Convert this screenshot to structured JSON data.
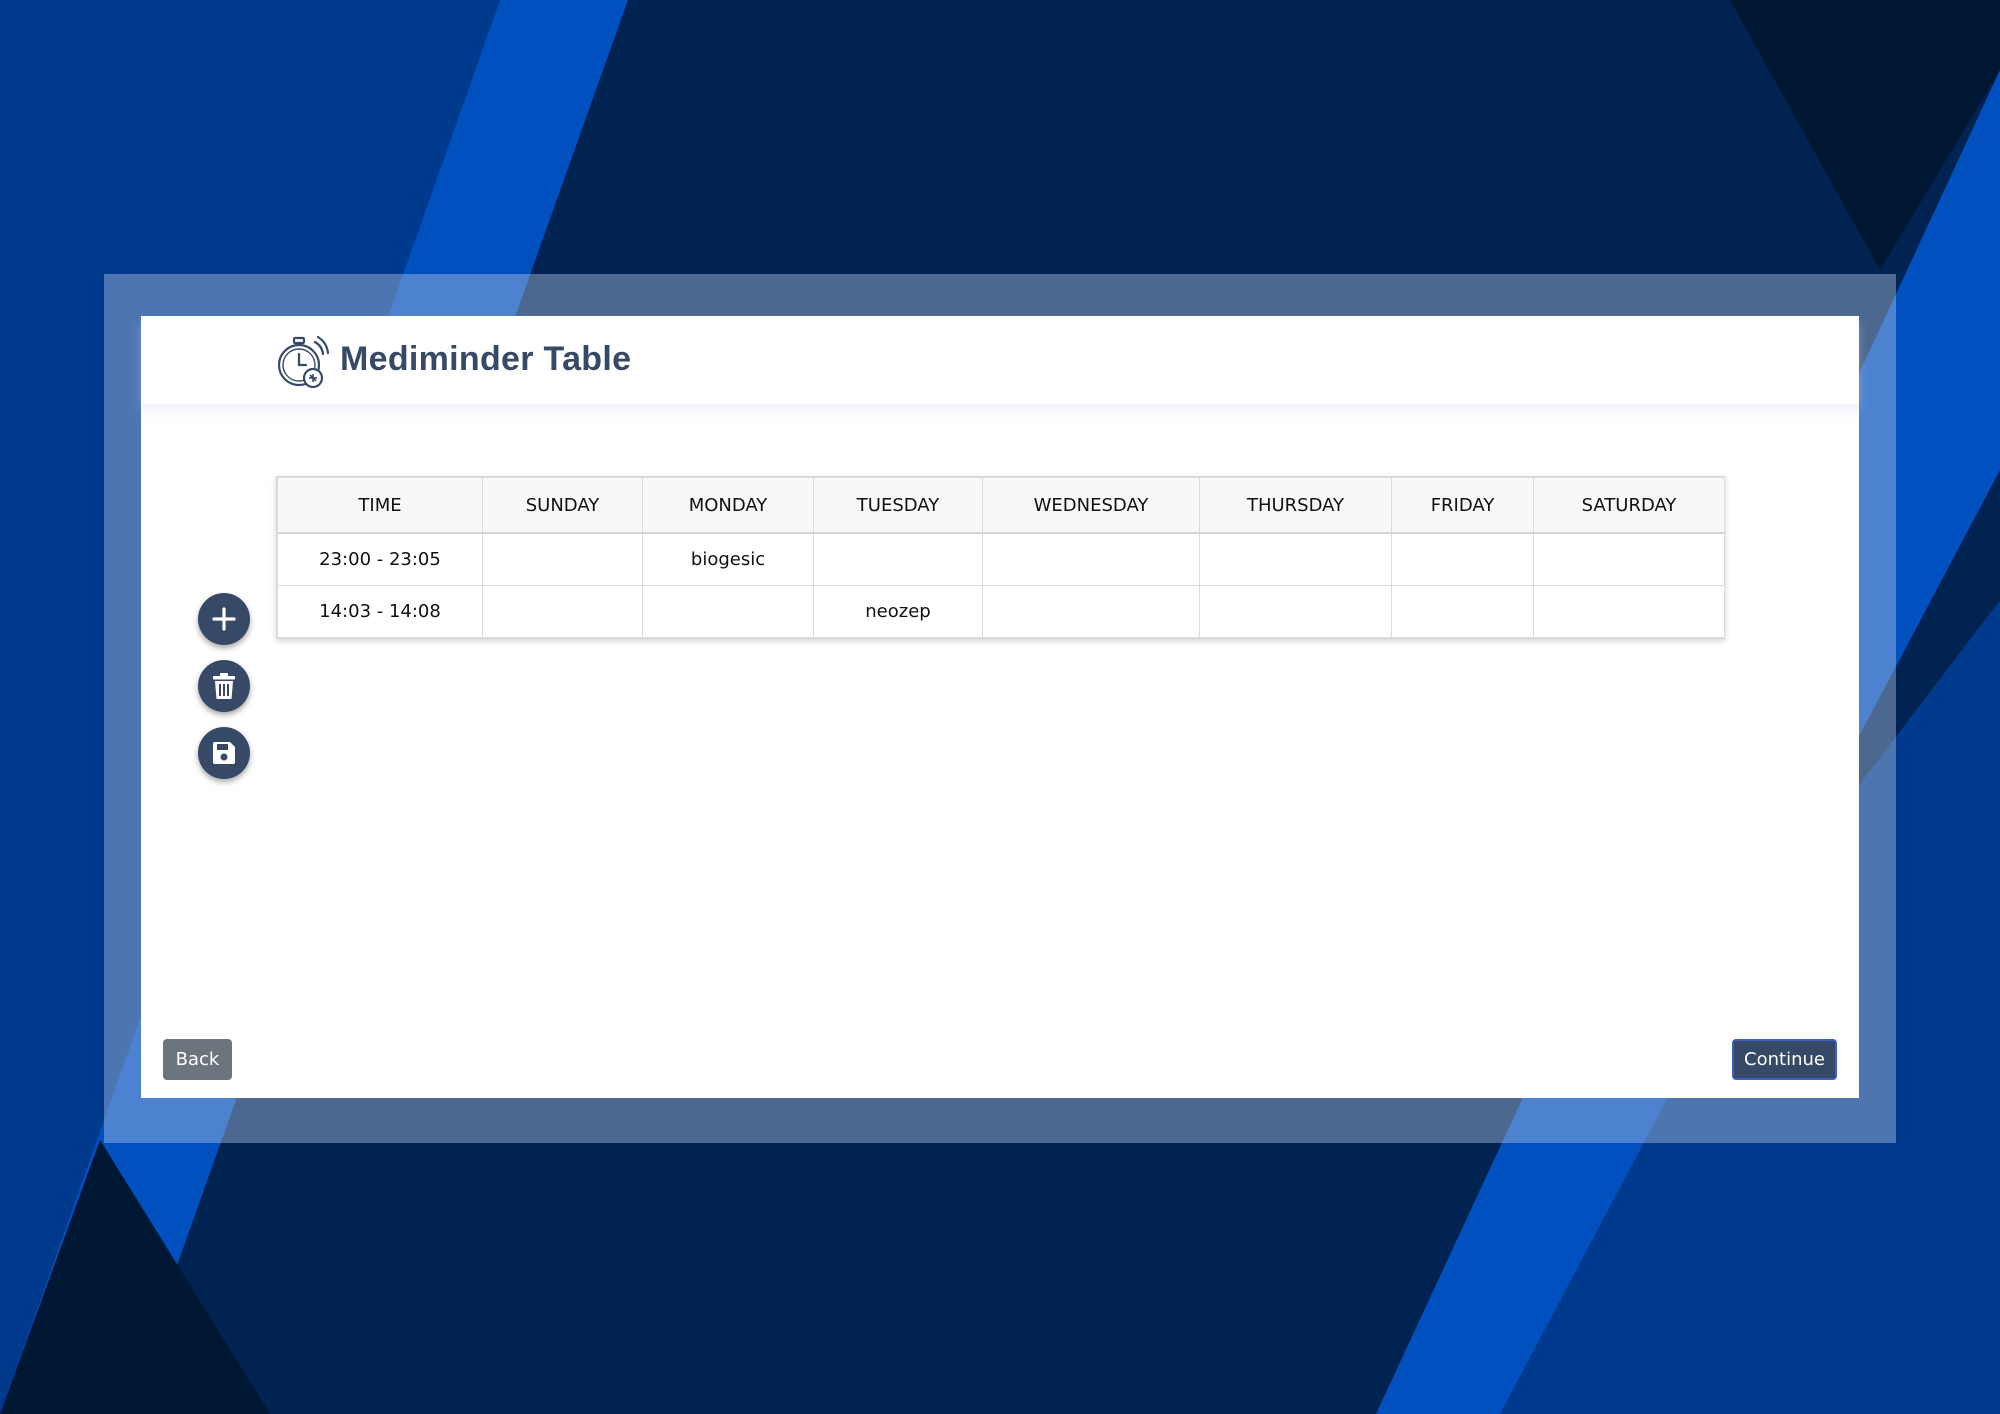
{
  "header": {
    "title": "Mediminder Table",
    "logo_icon": "stopwatch-medicine-icon"
  },
  "schedule": {
    "columns": [
      "TIME",
      "SUNDAY",
      "MONDAY",
      "TUESDAY",
      "WEDNESDAY",
      "THURSDAY",
      "FRIDAY",
      "SATURDAY"
    ],
    "rows": [
      [
        "23:00 - 23:05",
        "",
        "biogesic",
        "",
        "",
        "",
        "",
        ""
      ],
      [
        "14:03 - 14:08",
        "",
        "",
        "neozep",
        "",
        "",
        "",
        ""
      ]
    ]
  },
  "actions": {
    "add_icon": "plus-icon",
    "delete_icon": "trash-icon",
    "save_icon": "save-icon"
  },
  "footer": {
    "back_label": "Back",
    "continue_label": "Continue"
  },
  "colors": {
    "primary": "#364a68",
    "back_button": "#6c757d",
    "background": "#002352",
    "accent_stripe": "#0050c0"
  }
}
